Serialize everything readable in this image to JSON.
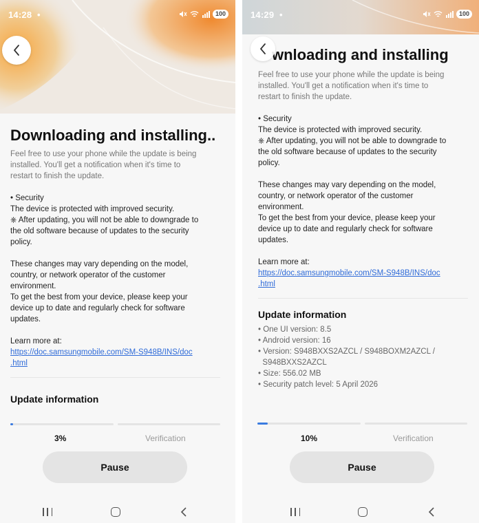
{
  "left": {
    "status": {
      "time": "14:28",
      "battery": "100"
    },
    "title": "Downloading and installing..",
    "subtitle_lines": [
      "Feel free to use your phone while the update is being",
      "installed. You'll get a notification when it's time to",
      "restart to finish the update."
    ],
    "security_lines": [
      "• Security",
      "The device is protected with improved security.",
      "⎈ After updating, you will not be able to downgrade to",
      "the old software because of updates to the security",
      "policy."
    ],
    "changes_lines": [
      "These changes may vary depending on the model,",
      "country, or network operator of the customer",
      "environment.",
      "To get the best from your device, please keep your",
      "device up to date and regularly check for software",
      "updates."
    ],
    "learn_more": "Learn more at:",
    "link_lines": [
      "https://doc.samsungmobile.com/SM-S948B/INS/doc",
      ".html"
    ],
    "update_info_title": "Update information",
    "progress_percent": "3%",
    "progress_fraction": 0.03,
    "verification_label": "Verification",
    "pause_label": "Pause"
  },
  "right": {
    "status": {
      "time": "14:29",
      "battery": "100"
    },
    "title": "wnloading and installing",
    "subtitle_lines": [
      "Feel free to use your phone while the update is being",
      "installed. You'll get a notification when it's time to",
      "restart to finish the update."
    ],
    "security_lines": [
      "• Security",
      "The device is protected with improved security.",
      "⎈ After updating, you will not be able to downgrade to",
      "the old software because of updates to the security",
      "policy."
    ],
    "changes_lines": [
      "These changes may vary depending on the model,",
      "country, or network operator of the customer",
      "environment.",
      "To get the best from your device, please keep your",
      "device up to date and regularly check for software",
      "updates."
    ],
    "learn_more": "Learn more at:",
    "link_lines": [
      "https://doc.samsungmobile.com/SM-S948B/INS/doc",
      ".html"
    ],
    "update_info_title": "Update information",
    "info_items": [
      "• One UI version: 8.5",
      "• Android version: 16",
      "• Version: S948BXXS2AZCL / S948BOXM2AZCL /",
      "  S948BXXS2AZCL",
      "• Size: 556.02 MB",
      "• Security patch level: 5 April 2026"
    ],
    "progress_percent": "10%",
    "progress_fraction": 0.1,
    "verification_label": "Verification",
    "pause_label": "Pause"
  },
  "icons": {
    "back": "chevron-left-icon",
    "mute": "mute-icon",
    "wifi": "wifi-icon",
    "signal": "signal-icon",
    "battery": "battery-icon",
    "nav_recent": "recent-apps-icon",
    "nav_home": "home-icon",
    "nav_back": "back-nav-icon"
  },
  "colors": {
    "accent": "#3a7be0",
    "link": "#2f6bd8",
    "button_bg": "#e4e4e4"
  }
}
